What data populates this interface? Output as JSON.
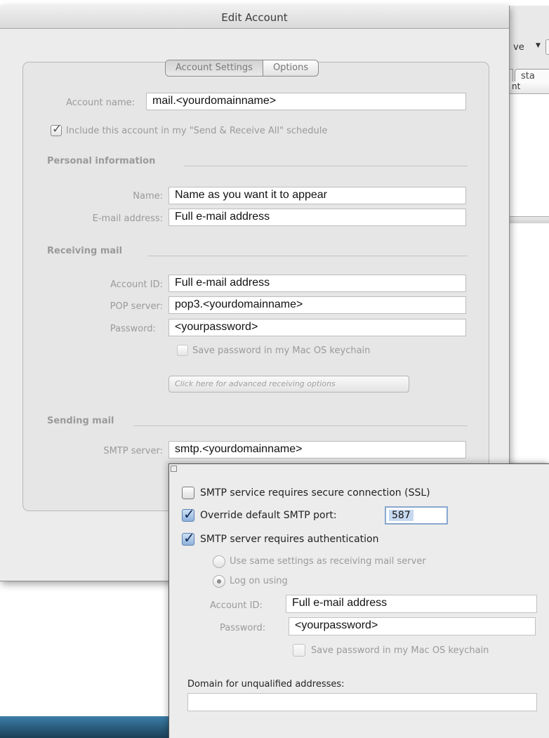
{
  "window": {
    "title": "Edit Account"
  },
  "tabs": [
    {
      "label": "Account Settings"
    },
    {
      "label": "Options"
    }
  ],
  "background_window": {
    "toolbar_text": "ve",
    "segment_text": "sta",
    "column_text": "nt"
  },
  "account": {
    "name_label": "Account name:",
    "name_value": "mail.<yourdomainname>",
    "include_label": "Include this account in my \"Send & Receive All\" schedule"
  },
  "personal": {
    "heading": "Personal information",
    "name_label": "Name:",
    "name_value": "Name as you want it to appear",
    "email_label": "E-mail address:",
    "email_value": "Full e-mail address"
  },
  "receiving": {
    "heading": "Receiving mail",
    "account_id_label": "Account ID:",
    "account_id_value": "Full e-mail address",
    "pop_label": "POP server:",
    "pop_value": "pop3.<yourdomainname>",
    "password_label": "Password:",
    "password_value": "<yourpassword>",
    "keychain_label": "Save password in my Mac OS keychain",
    "advanced_label": "Click here for advanced receiving options"
  },
  "sending": {
    "heading": "Sending mail",
    "smtp_label": "SMTP server:",
    "smtp_value": "smtp.<yourdomainname>"
  },
  "smtp_options": {
    "ssl_label": "SMTP service requires secure connection (SSL)",
    "override_label": "Override default SMTP port:",
    "port_value": "587",
    "auth_label": "SMTP server requires authentication",
    "same_settings_label": "Use same settings as receiving mail server",
    "logon_label": "Log on using",
    "account_id_label": "Account ID:",
    "account_id_value": "Full e-mail address",
    "password_label": "Password:",
    "password_value": "<yourpassword>",
    "keychain_label": "Save password in my Mac OS keychain",
    "domain_label": "Domain for unqualified addresses:",
    "domain_value": ""
  }
}
